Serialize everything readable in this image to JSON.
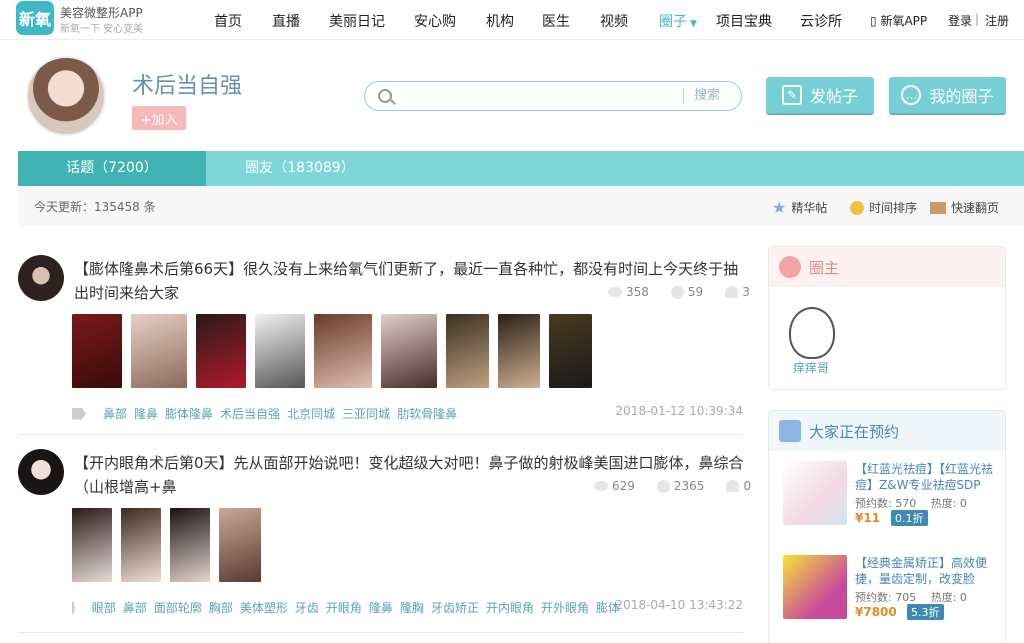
{
  "brand": {
    "logo_text": "新氧",
    "title": "美容微整形APP",
    "subtitle": "新氧一下 安心变美"
  },
  "nav": {
    "items": [
      "首页",
      "直播",
      "美丽日记",
      "安心购",
      "机构",
      "医生",
      "视频",
      "圈子",
      "项目宝典",
      "云诊所"
    ],
    "app_label": "新氧APP",
    "login": "登录",
    "sep": "|",
    "register": "注册"
  },
  "header": {
    "circle_name": "术后当自强",
    "join_label": "+加入",
    "search_placeholder": "",
    "search_button": "搜索",
    "post_button": "发帖子",
    "my_circle_button": "我的圈子"
  },
  "tabs": [
    {
      "label": "话题（7200）"
    },
    {
      "label": "圈友（183089）"
    }
  ],
  "subbar": {
    "today_update": "今天更新：135458 条",
    "sorts": [
      "精华帖",
      "时间排序",
      "快速翻页"
    ]
  },
  "posts": [
    {
      "title": "【膨体隆鼻术后第66天】很久没有上来给氧气们更新了，最近一直各种忙，都没有时间上今天终于抽出时间来给大家",
      "views": "358",
      "comments": "59",
      "likes": "3",
      "tags": [
        "鼻部",
        "隆鼻",
        "膨体隆鼻",
        "术后当自强",
        "北京同城",
        "三亚同城",
        "肋软骨隆鼻"
      ],
      "time": "2018-01-12 10:39:34"
    },
    {
      "title": "【开内眼角术后第0天】先从面部开始说吧！变化超级大对吧！鼻子做的射极峰美国进口膨体，鼻综合（山根增高+鼻",
      "views": "629",
      "comments": "2365",
      "likes": "0",
      "tags": [
        "眼部",
        "鼻部",
        "面部轮廓",
        "胸部",
        "美体塑形",
        "牙齿",
        "开眼角",
        "隆鼻",
        "隆胸",
        "牙齿矫正",
        "开内眼角",
        "开外眼角",
        "膨体"
      ],
      "time": "2018-04-10 13:43:22"
    }
  ],
  "sidebar": {
    "owner_title": "圈主",
    "owner_name": "痒痒哥",
    "booking_title": "大家正在预约",
    "bookings": [
      {
        "title": "【红蓝光祛痘】【红蓝光祛痘】Z&W专业祛痘SDP",
        "stats": "预约数: 570　 热度: 0",
        "price": "¥11",
        "discount": "0.1折"
      },
      {
        "title": "【经典金属矫正】高效便捷，量齿定制，改变脸",
        "stats": "预约数: 705　 热度: 0",
        "price": "¥7800",
        "discount": "5.3折"
      }
    ]
  }
}
